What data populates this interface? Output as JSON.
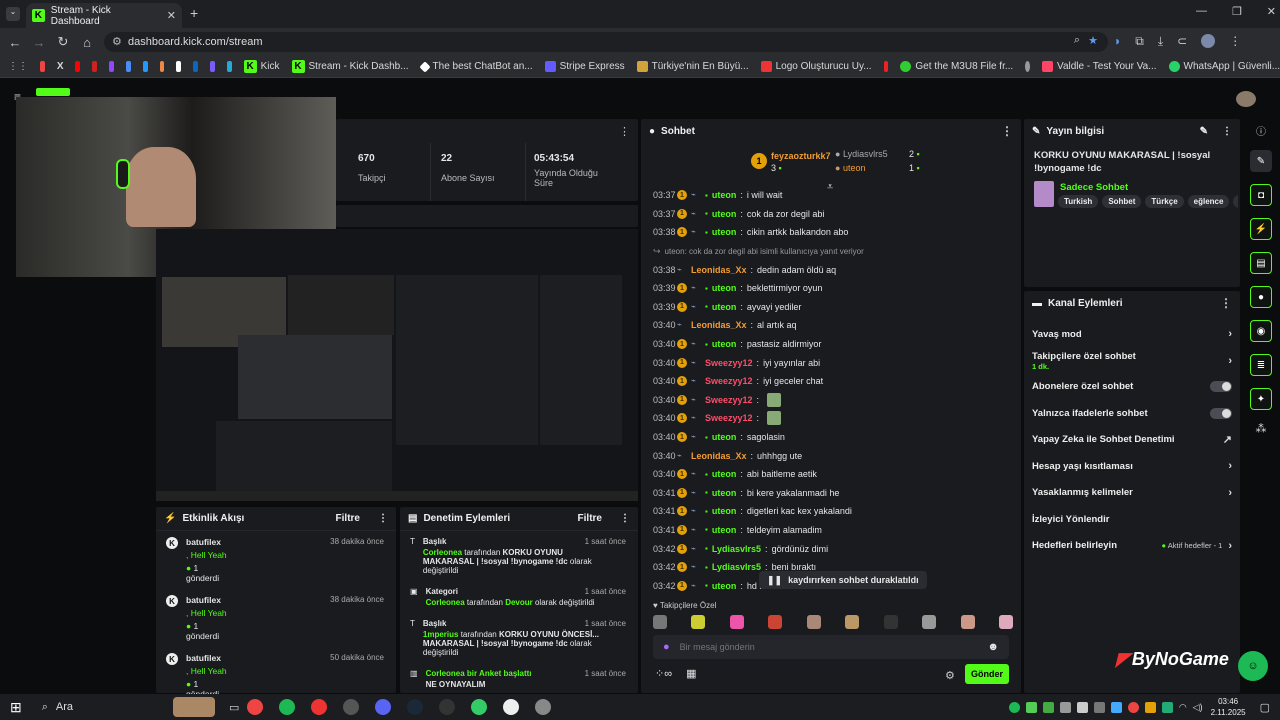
{
  "browser": {
    "tab_title": "Stream - Kick Dashboard",
    "url": "dashboard.kick.com/stream",
    "bookmarks": [
      "Kick",
      "Stream - Kick Dashb...",
      "The best ChatBot an...",
      "Stripe Express",
      "Türkiye'nin En Büyü...",
      "Logo Oluşturucu Uy...",
      "Get the M3U8 File fr...",
      "Valdle - Test Your Va...",
      "WhatsApp | Güvenli..."
    ]
  },
  "stats": [
    {
      "value": "670",
      "label": "Takipçi"
    },
    {
      "value": "22",
      "label": "Abone Sayısı"
    },
    {
      "value": "05:43:54",
      "label": "Yayında Olduğu Süre"
    }
  ],
  "chat": {
    "title": "Sohbet",
    "leaderboard": {
      "first_name": "feyzaozturkk7",
      "first_count": "3",
      "second_name": "Lydiasvlrs5",
      "second_count": "2",
      "third_name": "uteon",
      "third_count": "1"
    },
    "messages": [
      {
        "time": "03:37",
        "user": "uteon",
        "color": "green",
        "text": "i will wait"
      },
      {
        "time": "03:37",
        "user": "uteon",
        "color": "green",
        "text": "cok da zor degil abi"
      },
      {
        "time": "03:38",
        "user": "uteon",
        "color": "green",
        "text": "cikin artkk balkandon abo"
      },
      {
        "time": "",
        "user": "",
        "color": "",
        "text": "uteon: cok da zor degil abi isimli kullanıcıya yanıt veriyor",
        "reply": true
      },
      {
        "time": "03:38",
        "user": "Leonidas_Xx",
        "color": "orange",
        "text": "dedin adam öldü aq"
      },
      {
        "time": "03:39",
        "user": "uteon",
        "color": "green",
        "text": "beklettirmiyor oyun"
      },
      {
        "time": "03:39",
        "user": "uteon",
        "color": "green",
        "text": "ayvayi yediler"
      },
      {
        "time": "03:40",
        "user": "Leonidas_Xx",
        "color": "orange",
        "text": "al artık aq"
      },
      {
        "time": "03:40",
        "user": "uteon",
        "color": "green",
        "text": "pastasiz aldirmiyor"
      },
      {
        "time": "03:40",
        "user": "Sweezyy12",
        "color": "red",
        "text": "iyi yayınlar abi"
      },
      {
        "time": "03:40",
        "user": "Sweezyy12",
        "color": "red",
        "text": "iyi geceler chat"
      },
      {
        "time": "03:40",
        "user": "Sweezyy12",
        "color": "red",
        "text": ""
      },
      {
        "time": "03:40",
        "user": "Sweezyy12",
        "color": "red",
        "text": ""
      },
      {
        "time": "03:40",
        "user": "uteon",
        "color": "green",
        "text": "sagolasin"
      },
      {
        "time": "03:40",
        "user": "Leonidas_Xx",
        "color": "orange",
        "text": "uhhhgg ute"
      },
      {
        "time": "03:40",
        "user": "uteon",
        "color": "green",
        "text": "abi baitleme aetik"
      },
      {
        "time": "03:41",
        "user": "uteon",
        "color": "green",
        "text": "bi kere yakalanmadi he"
      },
      {
        "time": "03:41",
        "user": "uteon",
        "color": "green",
        "text": "digetleri kac kex yakalandi"
      },
      {
        "time": "03:41",
        "user": "uteon",
        "color": "green",
        "text": "teldeyim alamadim"
      },
      {
        "time": "03:42",
        "user": "Lydiasvlrs5",
        "color": "green",
        "text": "gördünüz dimi"
      },
      {
        "time": "03:42",
        "user": "Lydiasvlrs5",
        "color": "green",
        "text": "beni bıraktı"
      },
      {
        "time": "03:42",
        "user": "uteon",
        "color": "green",
        "text": "hd iz"
      }
    ],
    "paused_label": "kaydırırken sohbet duraklatıldı",
    "followers_only": "Takipçilere Özel",
    "input_placeholder": "Bir mesaj gönderin",
    "send": "Gönder"
  },
  "stream_info": {
    "title": "Yayın bilgisi",
    "stream_title": "KORKU OYUNU MAKARASAL | !sosyal !bynogame !dc",
    "category": "Sadece Sohbet",
    "tags": [
      "Turkish",
      "Sohbet",
      "Türkçe",
      "eğlence",
      "fp"
    ]
  },
  "channel_actions": {
    "title": "Kanal Eylemleri",
    "items": [
      {
        "label": "Yavaş mod",
        "kind": "chev"
      },
      {
        "label": "Takipçilere özel sohbet",
        "sub": "1 dk.",
        "kind": "chev"
      },
      {
        "label": "Abonelere özel sohbet",
        "kind": "toggle"
      },
      {
        "label": "Yalnızca ifadelerle sohbet",
        "kind": "toggle"
      },
      {
        "label": "Yapay Zeka ile Sohbet Denetimi",
        "kind": "ext"
      },
      {
        "label": "Hesap yaşı kısıtlaması",
        "kind": "chev"
      },
      {
        "label": "Yasaklanmış kelimeler",
        "kind": "chev"
      },
      {
        "label": "İzleyici Yönlendir",
        "kind": "none"
      },
      {
        "label": "Hedefleri belirleyin",
        "kind": "goal",
        "extra": "Aktif hedefler - 1"
      }
    ]
  },
  "activity": {
    "title": "Etkinlik Akışı",
    "filter": "Filtre",
    "items": [
      {
        "user": "batufilex",
        "msg": "Hell Yeah",
        "count": "1",
        "action": "gönderdi",
        "ago": "38 dakika önce"
      },
      {
        "user": "batufilex",
        "msg": "Hell Yeah",
        "count": "1",
        "action": "gönderdi",
        "ago": "38 dakika önce"
      },
      {
        "user": "batufilex",
        "msg": "Hell Yeah",
        "count": "1",
        "action": "gönderdi",
        "ago": "50 dakika önce"
      }
    ]
  },
  "moderation": {
    "title": "Denetim Eylemleri",
    "filter": "Filtre",
    "items": [
      {
        "head": "Başlık",
        "ago": "1 saat önce",
        "who": "Corleonea",
        "mid": "tarafından",
        "val": "KORKU OYUNU MAKARASAL | !sosyal !bynogame !dc",
        "tail": "olarak değiştirildi"
      },
      {
        "head": "Kategori",
        "ago": "1 saat önce",
        "who": "Corleonea",
        "mid": "tarafından",
        "val": "Devour",
        "tail": "olarak değiştirildi"
      },
      {
        "head": "Başlık",
        "ago": "1 saat önce",
        "who": "1mperius",
        "mid": "tarafından",
        "val": "KORKU OYUNU ÖNCESİ... MAKARASAL | !sosyal !bynogame !dc",
        "tail": "olarak değiştirildi"
      },
      {
        "head": "Corleonea bir Anket başlattı",
        "ago": "1 saat önce",
        "who": "",
        "mid": "",
        "val": "NE OYNAYALIM",
        "tail": ""
      }
    ]
  },
  "watermark": "ByNoGame",
  "taskbar": {
    "search": "Ara",
    "time": "03:46",
    "date": "2.11.2025"
  }
}
